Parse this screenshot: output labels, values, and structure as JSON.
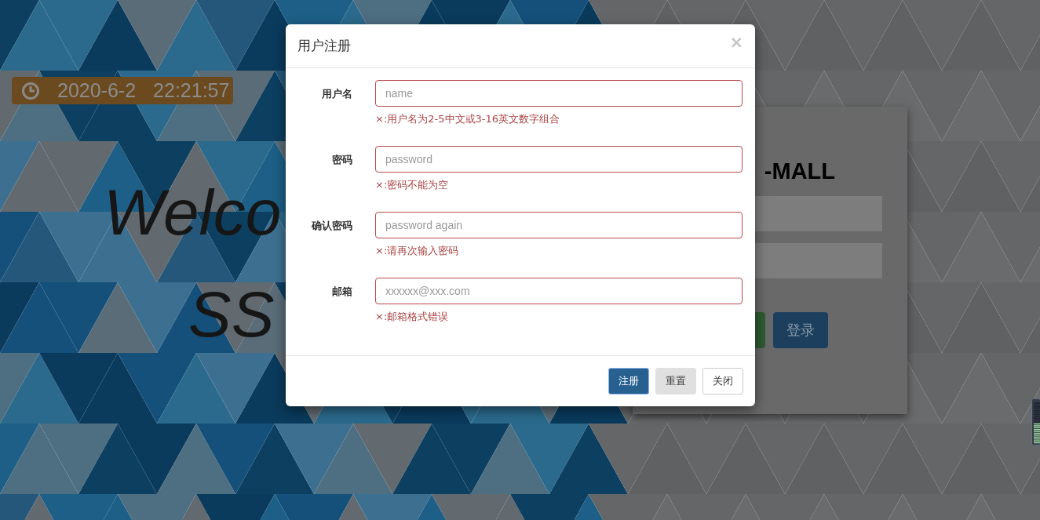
{
  "clock": {
    "date": "2020-6-2",
    "time": "22:21:57"
  },
  "welcome": [
    "Welco",
    "SS"
  ],
  "login_panel": {
    "title": "-MALL",
    "buttons": [
      {
        "kind": "success"
      },
      {
        "kind": "primary",
        "label": "登录"
      }
    ]
  },
  "modal": {
    "title": "用户注册",
    "close": "×",
    "fields": [
      {
        "label": "用户名",
        "placeholder": "name",
        "error": "×:用户名为2-5中文或3-16英文数字组合",
        "invalid": true
      },
      {
        "label": "密码",
        "placeholder": "password",
        "error": "×:密码不能为空",
        "invalid": true
      },
      {
        "label": "确认密码",
        "placeholder": "password again",
        "error": "×:请再次输入密码",
        "invalid": true
      },
      {
        "label": "邮箱",
        "placeholder": "xxxxxx@xxx.com",
        "error": "×:邮箱格式错误",
        "invalid": true
      }
    ],
    "buttons": [
      {
        "label": "注册",
        "kind": "primary"
      },
      {
        "label": "重置",
        "kind": "secondary"
      },
      {
        "label": "关闭",
        "kind": "default"
      }
    ]
  }
}
